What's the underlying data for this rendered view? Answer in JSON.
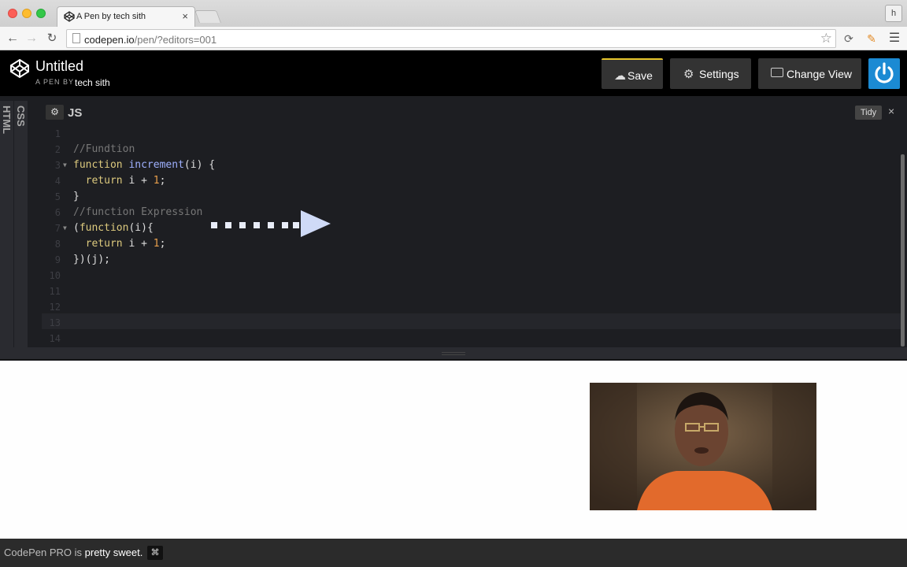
{
  "browser": {
    "tab_title": "A Pen by tech sith",
    "tab_close": "×",
    "profile_initial": "h",
    "url_host": "codepen.io",
    "url_path": "/pen/?editors=001"
  },
  "codepen": {
    "pen_title": "Untitled",
    "pen_by": "A PEN BY",
    "author": "tech sith",
    "buttons": {
      "save": "Save",
      "settings": "Settings",
      "change_view": "Change View"
    },
    "accent_color": "#e5c42b",
    "power_color": "#1b8ad3"
  },
  "editor": {
    "side_tabs": {
      "html": "HTML",
      "css": "CSS"
    },
    "panel_title": "JS",
    "tidy": "Tidy",
    "close": "×",
    "lines": [
      {
        "n": "1",
        "text": ""
      },
      {
        "n": "2",
        "text": "//Fundtion"
      },
      {
        "n": "3",
        "text": "function increment(i) {"
      },
      {
        "n": "4",
        "text": "  return i + 1;"
      },
      {
        "n": "5",
        "text": "}"
      },
      {
        "n": "6",
        "text": "//function Expression"
      },
      {
        "n": "7",
        "text": "(function(i){"
      },
      {
        "n": "8",
        "text": "  return i + 1;"
      },
      {
        "n": "9",
        "text": "})(j);"
      },
      {
        "n": "10",
        "text": ""
      },
      {
        "n": "11",
        "text": ""
      },
      {
        "n": "12",
        "text": ""
      },
      {
        "n": "13",
        "text": ""
      },
      {
        "n": "14",
        "text": ""
      }
    ]
  },
  "footer": {
    "brand": "CodePen PRO",
    "is": "is",
    "tagline": "pretty sweet.",
    "cmd": "⌘"
  }
}
